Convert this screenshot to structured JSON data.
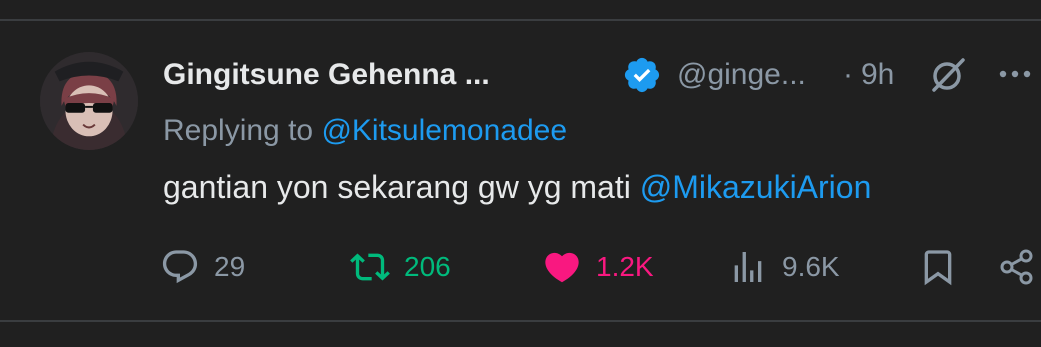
{
  "tweet": {
    "display_name": "Gingitsune Gehenna ...",
    "handle": "@ginge...",
    "separator": "·",
    "time": "9h",
    "replying_prefix": "Replying to",
    "replying_to": "@Kitsulemonadee",
    "text": "gantian yon sekarang gw yg mati",
    "text_mention": "@MikazukiArion"
  },
  "actions": {
    "replies": "29",
    "reposts": "206",
    "likes": "1.2K",
    "views": "9.6K"
  },
  "icons": {
    "verified": "verified-badge-icon",
    "grok": "grok-icon",
    "more": "more-icon",
    "reply": "reply-icon",
    "repost": "repost-icon",
    "like": "heart-icon",
    "views": "views-icon",
    "bookmark": "bookmark-icon",
    "share": "share-icon"
  },
  "colors": {
    "background": "#202020",
    "text": "#e7e9ea",
    "muted": "#8b98a5",
    "link": "#1d9bf0",
    "repost": "#00ba7c",
    "like": "#f91880"
  }
}
